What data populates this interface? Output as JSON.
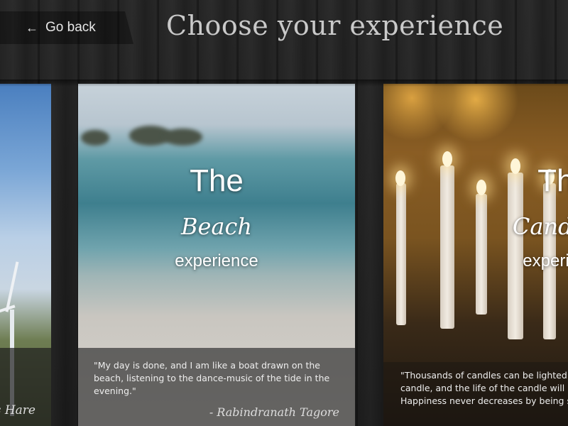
{
  "header": {
    "back_arrow": "←",
    "back_label": "Go back",
    "title": "Choose your experience"
  },
  "cards": [
    {
      "id": "wind",
      "author": "s Hare"
    },
    {
      "id": "beach",
      "the": "The",
      "name": "Beach",
      "experience": "experience",
      "quote": "\"My day is done, and I am like a boat drawn on the beach, listening to the dance-music of the tide in the evening.\"",
      "author": "- Rabindranath Tagore"
    },
    {
      "id": "candles",
      "the": "The",
      "name": "Candles",
      "experience": "experience",
      "quote": "\"Thousands of candles can be lighted from a single candle, and the life of the candle will not be shortened. Happiness never decreases by being shared.\""
    }
  ],
  "colors": {
    "title_text": "#c9c9c9",
    "caption_bg": "#373737",
    "wood": "#2b2b2b"
  }
}
